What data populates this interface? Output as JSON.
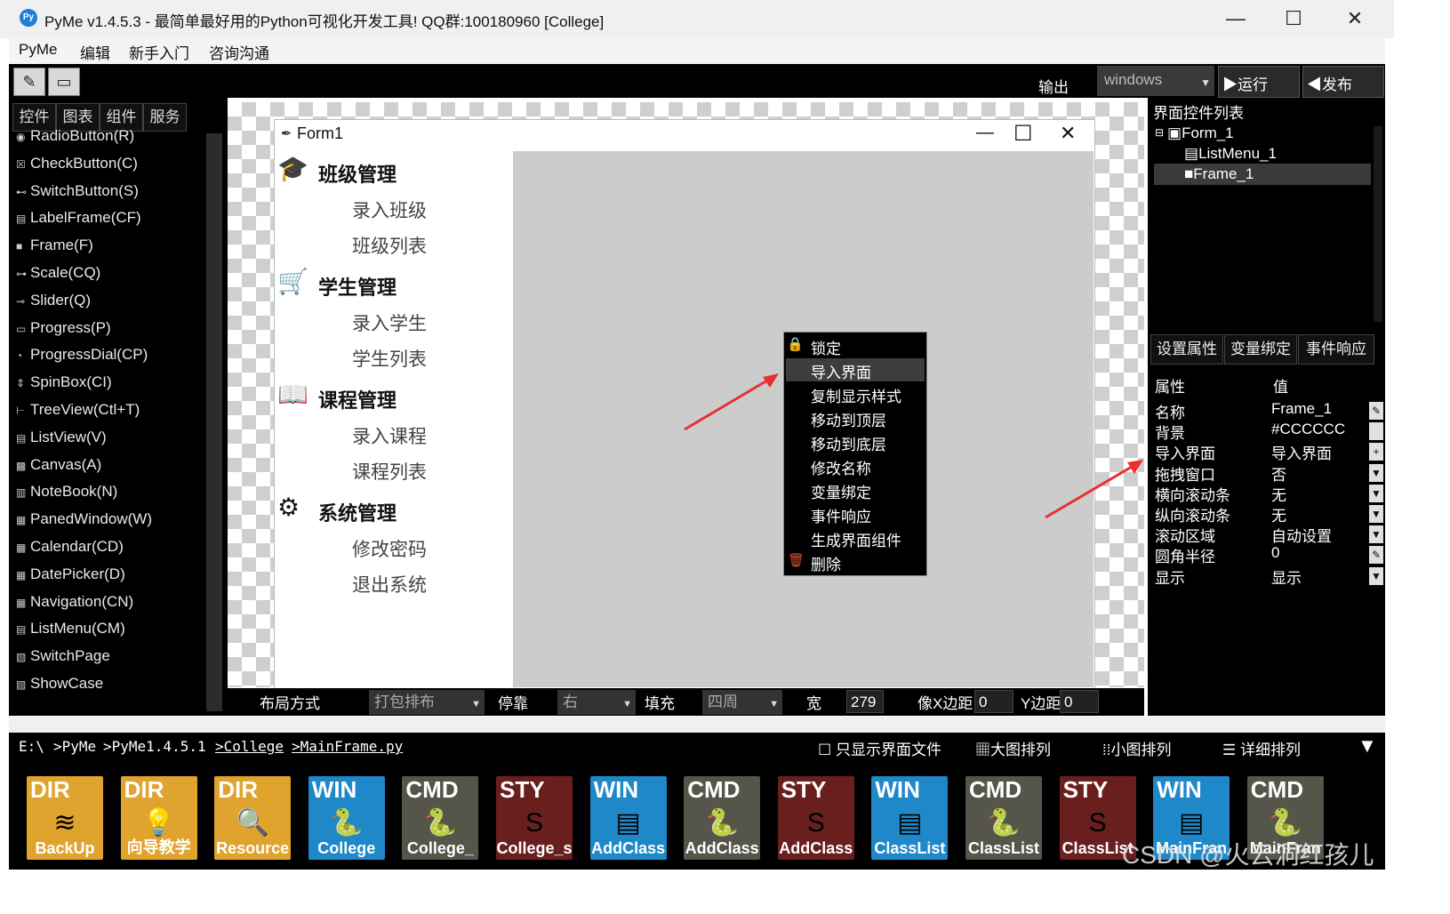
{
  "window": {
    "title": "PyMe v1.4.5.3 - 最简单最好用的Python可视化开发工具! QQ群:100180960     [College]",
    "icon_text": "Py",
    "minimize": "—",
    "maximize": "☐",
    "close": "✕"
  },
  "menu": [
    "PyMe",
    "编辑",
    "新手入门",
    "咨询沟通"
  ],
  "toolbar": {
    "output_label": "输出",
    "target": "windows",
    "run": "▶运行",
    "publish": "◀发布"
  },
  "left_panel": {
    "tabs": [
      "控件",
      "图表",
      "组件",
      "服务"
    ],
    "widgets": [
      {
        "icon": "◉",
        "label": "RadioButton(R)"
      },
      {
        "icon": "☒",
        "label": "CheckButton(C)"
      },
      {
        "icon": "⊷",
        "label": "SwitchButton(S)"
      },
      {
        "icon": "▤",
        "label": "LabelFrame(CF)"
      },
      {
        "icon": "■",
        "label": "Frame(F)"
      },
      {
        "icon": "⊶",
        "label": "Scale(CQ)"
      },
      {
        "icon": "⊸",
        "label": "Slider(Q)"
      },
      {
        "icon": "▭",
        "label": "Progress(P)"
      },
      {
        "icon": "◔",
        "label": "ProgressDial(CP)"
      },
      {
        "icon": "⇕",
        "label": "SpinBox(CI)"
      },
      {
        "icon": "⊢",
        "label": "TreeView(Ctl+T)"
      },
      {
        "icon": "▤",
        "label": "ListView(V)"
      },
      {
        "icon": "▩",
        "label": "Canvas(A)"
      },
      {
        "icon": "▥",
        "label": "NoteBook(N)"
      },
      {
        "icon": "▦",
        "label": "PanedWindow(W)"
      },
      {
        "icon": "▦",
        "label": "Calendar(CD)"
      },
      {
        "icon": "▦",
        "label": "DatePicker(D)"
      },
      {
        "icon": "▦",
        "label": "Navigation(CN)"
      },
      {
        "icon": "▤",
        "label": "ListMenu(CM)"
      },
      {
        "icon": "▧",
        "label": "SwitchPage"
      },
      {
        "icon": "▨",
        "label": "ShowCase"
      }
    ]
  },
  "form": {
    "title": "Form1",
    "minimize": "—",
    "maximize": "☐",
    "close": "✕",
    "menu_groups": [
      {
        "icon": "🎓",
        "title": "班级管理",
        "items": [
          "录入班级",
          "班级列表"
        ]
      },
      {
        "icon": "🛒",
        "title": "学生管理",
        "items": [
          "录入学生",
          "学生列表"
        ]
      },
      {
        "icon": "📖",
        "title": "课程管理",
        "items": [
          "录入课程",
          "课程列表"
        ]
      },
      {
        "icon": "⚙",
        "title": "系统管理",
        "items": [
          "修改密码",
          "退出系统"
        ]
      }
    ]
  },
  "context_menu": {
    "lock_icon": "🔒",
    "delete_icon": "🗑",
    "items": [
      "锁定",
      "导入界面",
      "复制显示样式",
      "移动到顶层",
      "移动到底层",
      "修改名称",
      "变量绑定",
      "事件响应",
      "生成界面组件",
      "删除"
    ],
    "highlighted": "导入界面"
  },
  "right_panel": {
    "title": "界面控件列表",
    "tree": [
      {
        "label": "Form_1",
        "expander": "⊟",
        "icon": "▣"
      },
      {
        "label": "ListMenu_1",
        "icon": "▤"
      },
      {
        "label": "Frame_1",
        "icon": "■",
        "selected": true
      }
    ],
    "tabs": [
      "设置属性",
      "变量绑定",
      "事件响应"
    ],
    "prop_header": {
      "name": "属性",
      "value": "值"
    },
    "properties": [
      {
        "name": "名称",
        "value": "Frame_1",
        "btn": "✎"
      },
      {
        "name": "背景",
        "value": "#CCCCCC",
        "btn": ""
      },
      {
        "name": "导入界面",
        "value": "导入界面",
        "btn": "+"
      },
      {
        "name": "拖拽窗口",
        "value": "否",
        "btn": "▼"
      },
      {
        "name": "横向滚动条",
        "value": "无",
        "btn": "▼"
      },
      {
        "name": "纵向滚动条",
        "value": "无",
        "btn": "▼"
      },
      {
        "name": "滚动区域",
        "value": "自动设置",
        "btn": "▼"
      },
      {
        "name": "圆角半径",
        "value": "0",
        "btn": "✎"
      },
      {
        "name": "显示",
        "value": "显示",
        "btn": "▼"
      }
    ]
  },
  "layout_bar": {
    "layout_label": "布局方式",
    "layout_value": "打包排布",
    "dock_label": "停靠",
    "dock_value": "右",
    "fill_label": "填充",
    "fill_value": "四周",
    "width_label": "宽",
    "width_value": "279",
    "xpad_label": "像X边距",
    "xpad_value": "0",
    "ypad_label": "Y边距",
    "ypad_value": "0"
  },
  "path_bar": {
    "segments": [
      "E:\\",
      ">PyMe",
      ">PyMe1.4.5.1",
      ">College",
      ">MainFrame.py"
    ],
    "only_ui_files": "只显示界面文件",
    "large_icons": "大图排列",
    "small_icons": "小图排列",
    "details": "详细排列"
  },
  "files": [
    {
      "type": "DIR",
      "name": "BackUp",
      "color": "#e0a32e",
      "icon": "≋"
    },
    {
      "type": "DIR",
      "name": "向导教学",
      "color": "#e0a32e",
      "icon": "💡"
    },
    {
      "type": "DIR",
      "name": "Resource",
      "color": "#e0a32e",
      "icon": "🔍"
    },
    {
      "type": "WIN",
      "name": "College",
      "color": "#1e88c9",
      "icon": "🐍"
    },
    {
      "type": "CMD",
      "name": "College_",
      "color": "#55554a",
      "icon": "🐍"
    },
    {
      "type": "STY",
      "name": "College_s",
      "color": "#6a1f1f",
      "icon": "S"
    },
    {
      "type": "WIN",
      "name": "AddClass",
      "color": "#1e88c9",
      "icon": "▤"
    },
    {
      "type": "CMD",
      "name": "AddClass",
      "color": "#55554a",
      "icon": "🐍"
    },
    {
      "type": "STY",
      "name": "AddClass",
      "color": "#6a1f1f",
      "icon": "S"
    },
    {
      "type": "WIN",
      "name": "ClassList",
      "color": "#1e88c9",
      "icon": "▤"
    },
    {
      "type": "CMD",
      "name": "ClassList",
      "color": "#55554a",
      "icon": "🐍"
    },
    {
      "type": "STY",
      "name": "ClassList",
      "color": "#6a1f1f",
      "icon": "S"
    },
    {
      "type": "WIN",
      "name": "MainFran",
      "color": "#1e88c9",
      "icon": "▤"
    },
    {
      "type": "CMD",
      "name": "MainFran",
      "color": "#55554a",
      "icon": "🐍"
    }
  ],
  "watermark": "CSDN @火云洞红孩儿"
}
